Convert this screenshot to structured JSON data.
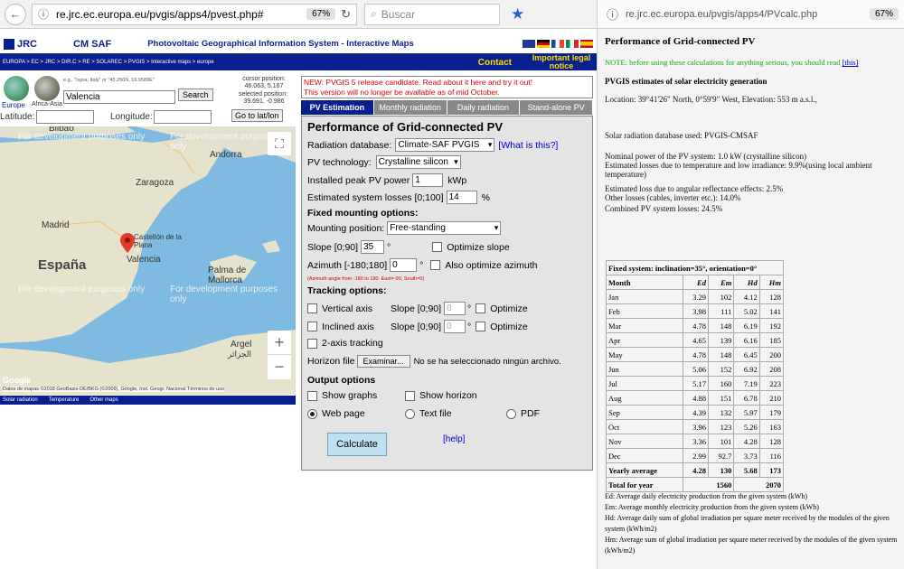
{
  "left_browser": {
    "url": "re.jrc.ec.europa.eu/pvgis/apps4/pvest.php#",
    "zoom": "67%",
    "search_placeholder": "Buscar"
  },
  "banner": {
    "jrc_logo": "JRC",
    "cmsaf_logo": "CM SAF",
    "title": "Photovoltaic Geographical Information System - Interactive Maps"
  },
  "navrow": {
    "breadcrumb": "EUROPA > EC > JRC > DIR.C > RE > SOLAREC > PVGIS > Interactive maps > europe",
    "contact": "Contact",
    "notice": "Important legal notice"
  },
  "locator": {
    "example_hint": "e.g., \"Ispra, Italy\" or \"45.256N, 16.9589E\"",
    "search_value": "Valencia",
    "search_button": "Search",
    "europe_label": "Europe",
    "africa_label": "Africa-Asia",
    "cursor_label": "cursor position:",
    "cursor_value": "46.063, 5.167",
    "selected_label": "selected position:",
    "selected_value": "39.691, -0.986",
    "latitude_label": "Latitude:",
    "longitude_label": "Longitude:",
    "goto_button": "Go to lat/lon"
  },
  "map": {
    "watermark": "For development purposes only",
    "places": [
      "Bilbao",
      "Andorra",
      "Zaragoza",
      "Madrid",
      "España",
      "Castellón de la Plana",
      "Valencia",
      "Palma de Mallorca",
      "Argel"
    ],
    "argel_ar": "الجزائر",
    "credits": "Datos de mapas ©2018 GeoBasis-DE/BKG (©2009), Google, Inst. Geogr. Nacional  Términos de uso",
    "google": "Google",
    "zoom_in": "+",
    "zoom_out": "−"
  },
  "map_tabs": [
    "Solar radiation",
    "Temperature",
    "Other maps"
  ],
  "notice": {
    "line1": "NEW: PVGIS 5 release candidate. Read about it here and try it out!",
    "line2": "This version will no longer be available as of mid October."
  },
  "tabs": [
    "PV Estimation",
    "Monthly radiation",
    "Daily radiation",
    "Stand-alone PV"
  ],
  "form": {
    "title": "Performance of Grid-connected PV",
    "radiation_label": "Radiation database:",
    "radiation_value": "Climate-SAF PVGIS",
    "what_link": "[What is this?]",
    "tech_label": "PV technology:",
    "tech_value": "Crystalline silicon",
    "peak_label": "Installed peak PV power",
    "peak_value": "1",
    "peak_unit": "kWp",
    "losses_label": "Estimated system losses [0;100]",
    "losses_value": "14",
    "losses_unit": "%",
    "fixed_head": "Fixed mounting options:",
    "mounting_label": "Mounting position:",
    "mounting_value": "Free-standing",
    "slope_label": "Slope [0;90]",
    "slope_value": "35",
    "deg": "°",
    "optimize_slope": "Optimize slope",
    "azimuth_label": "Azimuth [-180;180]",
    "azimuth_value": "0",
    "also_optimize": "Also optimize azimuth",
    "azimuth_hint": "(Azimuth angle from -180 to 180. East=-90, South=0)",
    "tracking_head": "Tracking options:",
    "vertical_axis": "Vertical axis",
    "inclined_axis": "Inclined axis",
    "two_axis": "2-axis tracking",
    "slope_small": "Slope [0;90]",
    "slope_small_val": "0",
    "optimize": "Optimize",
    "horizon_label": "Horizon file",
    "browse": "Examinar...",
    "no_file": "No se ha seleccionado ningún archivo.",
    "output_head": "Output options",
    "show_graphs": "Show graphs",
    "show_horizon": "Show horizon",
    "web_page": "Web page",
    "text_file": "Text file",
    "pdf": "PDF",
    "calculate": "Calculate",
    "help": "[help]"
  },
  "right_browser": {
    "url": "re.jrc.ec.europa.eu/pvgis/apps4/PVcalc.php",
    "zoom": "67%"
  },
  "report": {
    "title": "Performance of Grid-connected PV",
    "note": "NOTE: before using these calculations for anything serious, you should read",
    "note_link": "[this]",
    "subtitle": "PVGIS estimates of solar electricity generation",
    "location": "Location: 39°41'26\" North, 0°59'9\" West, Elevation: 553 m a.s.l.,",
    "database": "Solar radiation database used: PVGIS-CMSAF",
    "nominal": "Nominal power of the PV system: 1.0 kW (crystalline silicon)",
    "loss_temp": "Estimated losses due to temperature and low irradiance: 9.9%(using local ambient temperature)",
    "loss_angle": "Estimated loss due to angular reflectance effects: 2.5%",
    "loss_other": "Other losses (cables, inverter etc.): 14.0%",
    "loss_combined": "Combined PV system losses: 24.5%",
    "table_caption": "Fixed system: inclination=35°, orientation=0°",
    "headers": [
      "Month",
      "Ed",
      "Em",
      "Hd",
      "Hm"
    ],
    "rows": [
      [
        "Jan",
        "3.29",
        "102",
        "4.12",
        "128"
      ],
      [
        "Feb",
        "3.98",
        "111",
        "5.02",
        "141"
      ],
      [
        "Mar",
        "4.78",
        "148",
        "6.19",
        "192"
      ],
      [
        "Apr",
        "4.65",
        "139",
        "6.16",
        "185"
      ],
      [
        "May",
        "4.78",
        "148",
        "6.45",
        "200"
      ],
      [
        "Jun",
        "5.06",
        "152",
        "6.92",
        "208"
      ],
      [
        "Jul",
        "5.17",
        "160",
        "7.19",
        "223"
      ],
      [
        "Aug",
        "4.88",
        "151",
        "6.78",
        "210"
      ],
      [
        "Sep",
        "4.39",
        "132",
        "5.97",
        "179"
      ],
      [
        "Oct",
        "3.96",
        "123",
        "5.26",
        "163"
      ],
      [
        "Nov",
        "3.36",
        "101",
        "4.28",
        "128"
      ],
      [
        "Dec",
        "2.99",
        "92.7",
        "3.73",
        "116"
      ]
    ],
    "yearly": [
      "Yearly average",
      "4.28",
      "130",
      "5.68",
      "173"
    ],
    "total": [
      "Total for year",
      "1560",
      "2070"
    ],
    "legend": [
      "Ed: Average daily electricity production from the given system (kWh)",
      "Em: Average monthly electricity production from the given system (kWh)",
      "Hd: Average daily sum of global irradiation per square meter received by the modules of the given system (kWh/m2)",
      "Hm: Average sum of global irradiation per square meter received by the modules of the given system (kWh/m2)"
    ]
  }
}
